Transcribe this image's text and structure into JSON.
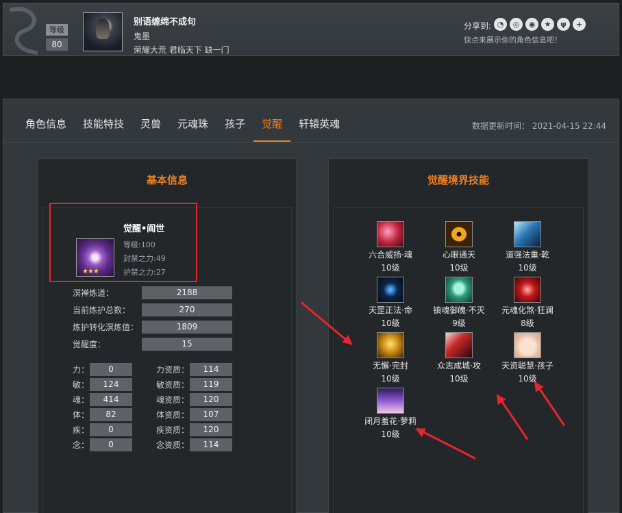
{
  "profile": {
    "level_label": "等级",
    "level_value": "80",
    "name": "别语缠绵不成句",
    "school": "鬼墨",
    "server": "荣耀大荒 君临天下 缺一门",
    "share_label": "分享到:",
    "share_hint": "快点来展示你的角色信息吧！",
    "share_icons": [
      "wechat-icon",
      "qq-icon",
      "weibo-icon",
      "qzone-icon",
      "tencent-weibo-icon",
      "more-icon"
    ]
  },
  "tabs": [
    "角色信息",
    "技能特技",
    "灵兽",
    "元魂珠",
    "孩子",
    "觉醒",
    "轩辕英魂"
  ],
  "active_tab": "觉醒",
  "update_time": "数据更新时间： 2021-04-15 22:44",
  "basic": {
    "title": "基本信息",
    "awaken_name": "觉醒•阎世",
    "awaken_level": "等级:100",
    "awaken_seal": "封禁之力:49",
    "awaken_guard": "护禁之力:27",
    "stats": [
      {
        "label": "溟禅炼道：",
        "value": "2188"
      },
      {
        "label": "当前炼护总数：",
        "value": "270"
      },
      {
        "label": "炼护转化溟炼值：",
        "value": "1809"
      },
      {
        "label": "觉醒度：",
        "value": "15"
      }
    ],
    "attrs": [
      {
        "label": "力：",
        "value": "0",
        "apt_label": "力资质：",
        "apt_value": "114"
      },
      {
        "label": "敏：",
        "value": "124",
        "apt_label": "敏资质：",
        "apt_value": "119"
      },
      {
        "label": "魂：",
        "value": "414",
        "apt_label": "魂资质：",
        "apt_value": "120"
      },
      {
        "label": "体：",
        "value": "82",
        "apt_label": "体资质：",
        "apt_value": "107"
      },
      {
        "label": "疾：",
        "value": "0",
        "apt_label": "疾资质：",
        "apt_value": "120"
      },
      {
        "label": "念：",
        "value": "0",
        "apt_label": "念资质：",
        "apt_value": "114"
      }
    ]
  },
  "skills": {
    "title": "觉醒境界技能",
    "items": [
      {
        "name": "六合威扬·魂",
        "level": "10级",
        "icon": "soul-skill-icon"
      },
      {
        "name": "心眼通天",
        "level": "10级",
        "icon": "eye-skill-icon"
      },
      {
        "name": "道强法重·乾",
        "level": "10级",
        "icon": "qian-skill-icon"
      },
      {
        "name": "天罡正法·命",
        "level": "10级",
        "icon": "constellation-skill-icon"
      },
      {
        "name": "镇魂御魄·不灭",
        "level": "9级",
        "icon": "ghost-face-skill-icon"
      },
      {
        "name": "元魂化煞·狂澜",
        "level": "8级",
        "icon": "demon-mask-skill-icon"
      },
      {
        "name": "无懈·完封",
        "level": "10级",
        "icon": "shield-skill-icon"
      },
      {
        "name": "众志成城·攻",
        "level": "10级",
        "icon": "attack-skill-icon"
      },
      {
        "name": "天资聪慧·孩子",
        "level": "10级",
        "icon": "baby-skill-icon"
      },
      {
        "name": "闭月羞花·萝莉",
        "level": "10级",
        "icon": "loli-skill-icon"
      }
    ]
  },
  "colors": {
    "accent": "#f08020",
    "highlight": "#e8252a"
  }
}
